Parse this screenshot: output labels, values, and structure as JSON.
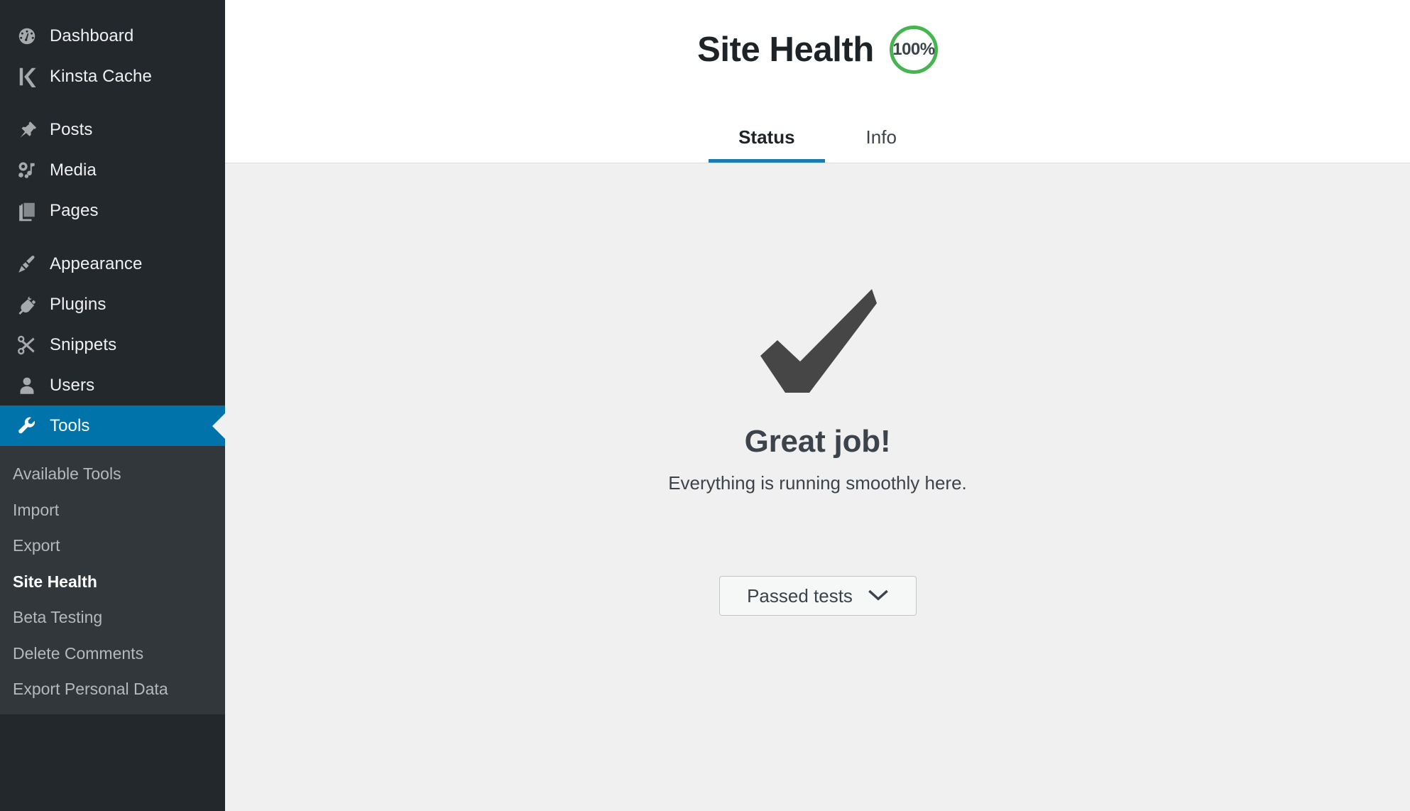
{
  "sidebar": {
    "items": [
      {
        "label": "Dashboard",
        "icon": "dashboard-gauge-icon",
        "active": false
      },
      {
        "label": "Kinsta Cache",
        "icon": "kinsta-k-icon",
        "active": false
      },
      {
        "label": "Posts",
        "icon": "pushpin-icon",
        "active": false
      },
      {
        "label": "Media",
        "icon": "media-camera-music-icon",
        "active": false
      },
      {
        "label": "Pages",
        "icon": "pages-stack-icon",
        "active": false
      },
      {
        "label": "Appearance",
        "icon": "paintbrush-icon",
        "active": false
      },
      {
        "label": "Plugins",
        "icon": "plug-icon",
        "active": false
      },
      {
        "label": "Snippets",
        "icon": "scissors-icon",
        "active": false
      },
      {
        "label": "Users",
        "icon": "user-icon",
        "active": false
      },
      {
        "label": "Tools",
        "icon": "wrench-icon",
        "active": true
      }
    ],
    "submenu": [
      {
        "label": "Available Tools",
        "current": false
      },
      {
        "label": "Import",
        "current": false
      },
      {
        "label": "Export",
        "current": false
      },
      {
        "label": "Site Health",
        "current": true
      },
      {
        "label": "Beta Testing",
        "current": false
      },
      {
        "label": "Delete Comments",
        "current": false
      },
      {
        "label": "Export Personal Data",
        "current": false
      }
    ],
    "colors": {
      "background": "#23282d",
      "submenu_background": "#32373c",
      "active_item": "#0073aa",
      "label": "#f0f0f1",
      "submenu_label": "#b4b9be"
    }
  },
  "header": {
    "title": "Site Health",
    "score_badge": "100%",
    "badge_ring_color": "#46b450",
    "tabs": [
      {
        "label": "Status",
        "active": true
      },
      {
        "label": "Info",
        "active": false
      }
    ],
    "active_tab_underline_color": "#1a7cb0"
  },
  "content": {
    "status_icon": "checkmark-icon",
    "status_icon_color": "#464646",
    "heading": "Great job!",
    "subtext": "Everything is running smoothly here.",
    "passed_tests_button": {
      "label": "Passed tests",
      "icon": "chevron-down-icon"
    },
    "background": "#f0f0f1"
  }
}
